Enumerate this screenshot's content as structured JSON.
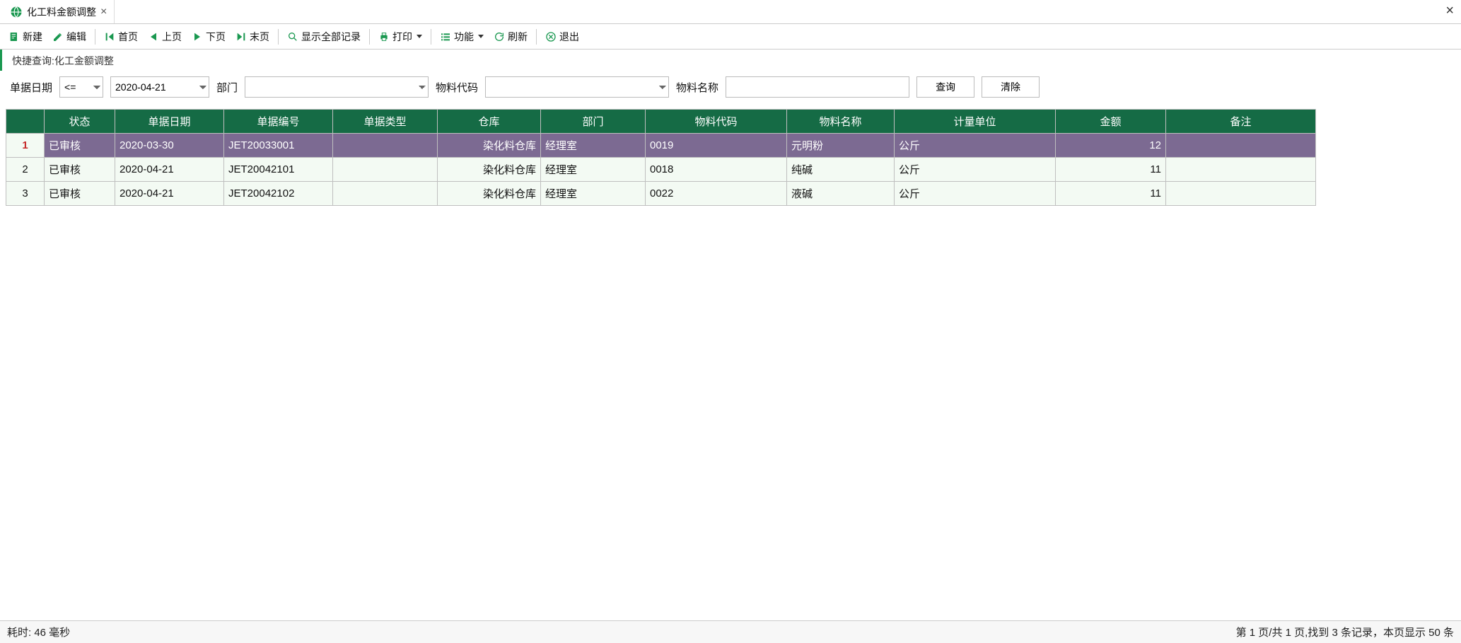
{
  "tab": {
    "title": "化工料金额调整"
  },
  "toolbar": {
    "new": "新建",
    "edit": "编辑",
    "first": "首页",
    "prev": "上页",
    "next": "下页",
    "last": "末页",
    "showall": "显示全部记录",
    "print": "打印",
    "func": "功能",
    "refresh": "刷新",
    "exit": "退出"
  },
  "quicksearch": {
    "label": "快捷查询:化工金额调整"
  },
  "filters": {
    "date_label": "单据日期",
    "op_value": "<=",
    "date_value": "2020-04-21",
    "dept_label": "部门",
    "dept_value": "",
    "matcode_label": "物料代码",
    "matcode_value": "",
    "matname_label": "物料名称",
    "matname_value": "",
    "query_btn": "查询",
    "clear_btn": "清除"
  },
  "grid": {
    "headers": {
      "rownum": "",
      "status": "状态",
      "date": "单据日期",
      "docno": "单据编号",
      "doctype": "单据类型",
      "warehouse": "仓库",
      "dept": "部门",
      "matcode": "物料代码",
      "matname": "物料名称",
      "uom": "计量单位",
      "amount": "金额",
      "remark": "备注"
    },
    "rows": [
      {
        "n": "1",
        "status": "已审核",
        "date": "2020-03-30",
        "docno": "JET20033001",
        "doctype": "",
        "warehouse": "染化料仓库",
        "dept": "经理室",
        "matcode": "0019",
        "matname": "元明粉",
        "uom": "公斤",
        "amount": "12",
        "remark": "",
        "selected": true
      },
      {
        "n": "2",
        "status": "已审核",
        "date": "2020-04-21",
        "docno": "JET20042101",
        "doctype": "",
        "warehouse": "染化料仓库",
        "dept": "经理室",
        "matcode": "0018",
        "matname": "纯碱",
        "uom": "公斤",
        "amount": "11",
        "remark": "",
        "selected": false
      },
      {
        "n": "3",
        "status": "已审核",
        "date": "2020-04-21",
        "docno": "JET20042102",
        "doctype": "",
        "warehouse": "染化料仓库",
        "dept": "经理室",
        "matcode": "0022",
        "matname": "液碱",
        "uom": "公斤",
        "amount": "11",
        "remark": "",
        "selected": false
      }
    ]
  },
  "status": {
    "left": "耗时: 46 毫秒",
    "right": "第 1 页/共 1 页,找到 3 条记录，本页显示 50 条"
  }
}
